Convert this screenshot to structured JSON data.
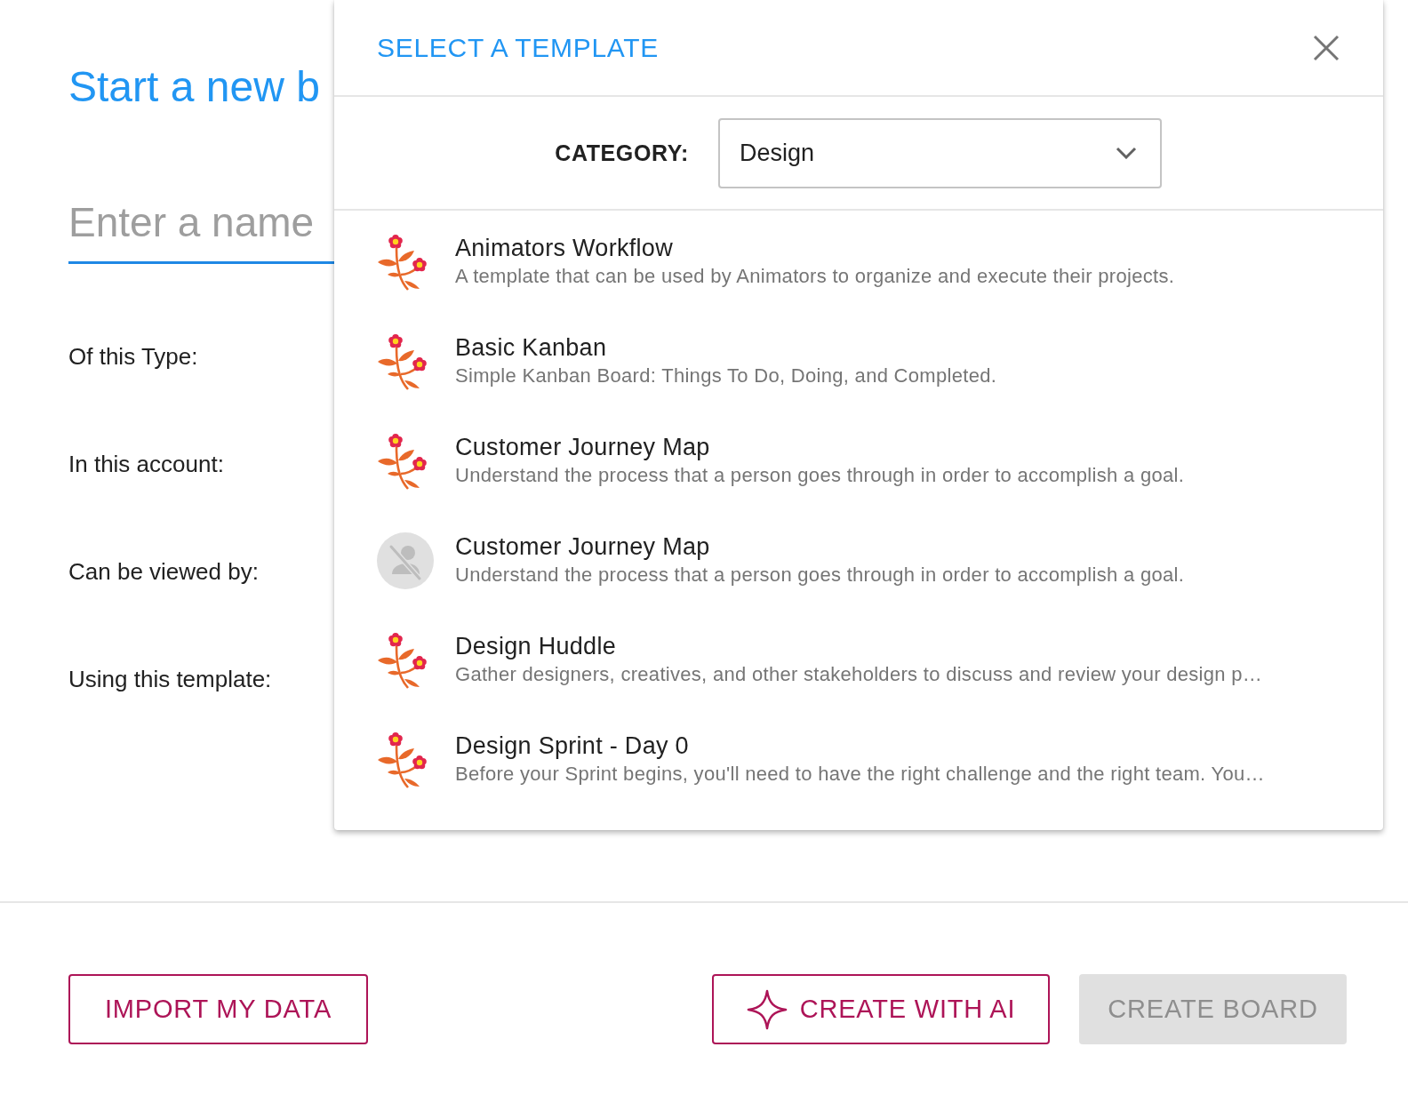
{
  "page": {
    "heading": "Start a new b",
    "name_field": {
      "placeholder": "Enter a name",
      "focused": true
    },
    "field_labels": [
      "Of this Type:",
      "In this account:",
      "Can be viewed by:",
      "Using this template:"
    ]
  },
  "dialog": {
    "title": "SELECT A TEMPLATE",
    "category": {
      "label": "CATEGORY:",
      "value": "Design"
    },
    "templates": [
      {
        "kind": "flower",
        "title": "Animators Workflow",
        "description": "A template that can be used by Animators to organize and execute their projects."
      },
      {
        "kind": "flower",
        "title": "Basic Kanban",
        "description": "Simple Kanban Board: Things To Do, Doing, and Completed."
      },
      {
        "kind": "flower",
        "title": "Customer Journey Map",
        "description": "Understand the process that a person goes through in order to accomplish a goal."
      },
      {
        "kind": "no-image",
        "title": "Customer Journey Map",
        "description": "Understand the process that a person goes through in order to accomplish a goal."
      },
      {
        "kind": "flower",
        "title": "Design Huddle",
        "description": "Gather designers, creatives, and other stakeholders to discuss and review your design p…"
      },
      {
        "kind": "flower",
        "title": "Design Sprint - Day 0",
        "description": "Before your Sprint begins, you'll need to have the right challenge and the right team. You…"
      }
    ]
  },
  "buttons": [
    {
      "kind": "outlined",
      "label": "IMPORT MY DATA",
      "disabled": false
    },
    {
      "kind": "ai",
      "label": "CREATE WITH AI",
      "disabled": false
    },
    {
      "kind": "contained",
      "label": "CREATE BOARD",
      "disabled": true
    }
  ]
}
